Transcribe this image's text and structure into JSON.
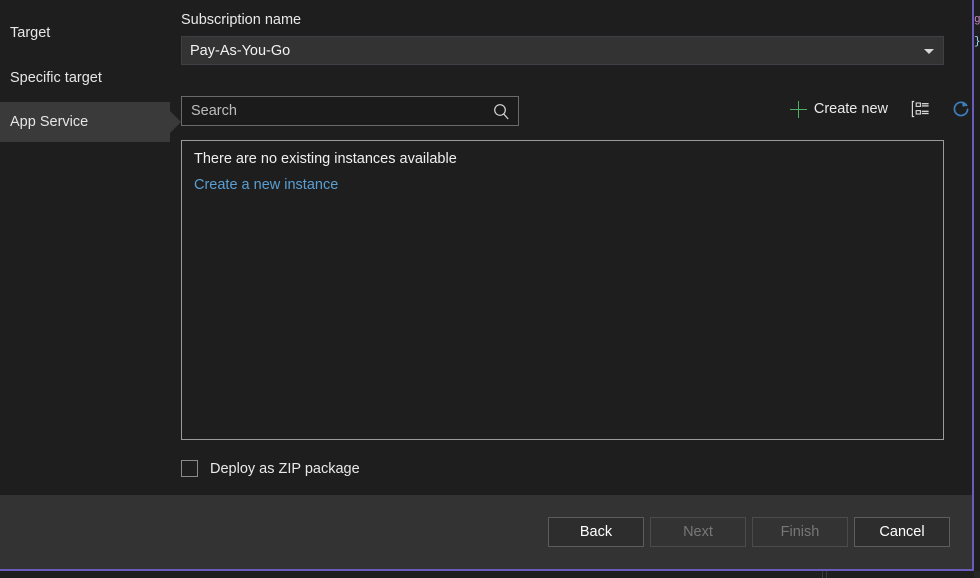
{
  "backdrop": {
    "code_line_1": "g",
    "code_line_2": "};"
  },
  "sidebar": {
    "items": [
      {
        "id": "target",
        "label": "Target",
        "selected": false
      },
      {
        "id": "specific",
        "label": "Specific target",
        "selected": false
      },
      {
        "id": "app-service",
        "label": "App Service",
        "selected": true
      }
    ]
  },
  "pane": {
    "subscription": {
      "label": "Subscription name",
      "selected_value": "Pay-As-You-Go",
      "options": [
        "Pay-As-You-Go"
      ]
    },
    "search": {
      "placeholder": "Search",
      "value": "",
      "icon": "search-icon"
    },
    "toolbar": {
      "create_new_label": "Create new",
      "create_new_icon": "plus-icon",
      "group_icon": "group-by-icon",
      "refresh_icon": "refresh-icon",
      "plus_color": "#4caf64",
      "refresh_color": "#3d7fc1"
    },
    "instances": {
      "empty_message": "There are no existing instances available",
      "create_link": "Create a new instance",
      "link_color": "#5a9fd4"
    },
    "zip": {
      "label": "Deploy as ZIP package",
      "checked": false
    }
  },
  "footer": {
    "buttons": [
      {
        "id": "back",
        "label": "Back",
        "enabled": true
      },
      {
        "id": "next",
        "label": "Next",
        "enabled": false
      },
      {
        "id": "finish",
        "label": "Finish",
        "enabled": false
      },
      {
        "id": "cancel",
        "label": "Cancel",
        "enabled": true
      }
    ]
  }
}
